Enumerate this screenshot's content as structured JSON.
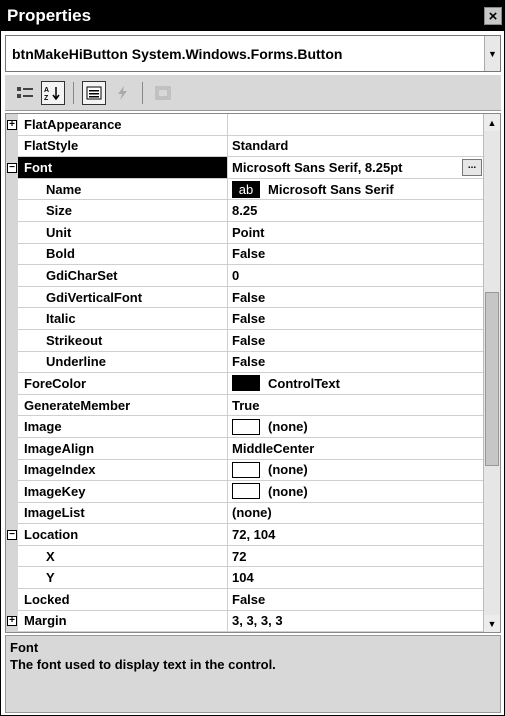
{
  "window": {
    "title": "Properties",
    "close_glyph": "×"
  },
  "object_selector": {
    "value": "btnMakeHiButton System.Windows.Forms.Button"
  },
  "toolbar": {
    "buttons": [
      "categorized-icon",
      "alphabetical-icon",
      "properties-icon",
      "events-icon",
      "property-pages-icon"
    ]
  },
  "rows": [
    {
      "name": "FlatAppearance",
      "value": "",
      "expander": "+",
      "indent": false
    },
    {
      "name": "FlatStyle",
      "value": "Standard",
      "indent": false
    },
    {
      "name": "Font",
      "value": "Microsoft Sans Serif, 8.25pt",
      "expander": "−",
      "selected": true,
      "indent": false,
      "button": "..."
    },
    {
      "name": "Name",
      "value": "Microsoft Sans Serif",
      "indent": true,
      "sample": "ab"
    },
    {
      "name": "Size",
      "value": "8.25",
      "indent": true
    },
    {
      "name": "Unit",
      "value": "Point",
      "indent": true
    },
    {
      "name": "Bold",
      "value": "False",
      "indent": true
    },
    {
      "name": "GdiCharSet",
      "value": "0",
      "indent": true
    },
    {
      "name": "GdiVerticalFont",
      "value": "False",
      "indent": true
    },
    {
      "name": "Italic",
      "value": "False",
      "indent": true
    },
    {
      "name": "Strikeout",
      "value": "False",
      "indent": true
    },
    {
      "name": "Underline",
      "value": "False",
      "indent": true
    },
    {
      "name": "ForeColor",
      "value": "ControlText",
      "indent": false,
      "swatch": "black"
    },
    {
      "name": "GenerateMember",
      "value": "True",
      "indent": false
    },
    {
      "name": "Image",
      "value": "(none)",
      "indent": false,
      "swatch": "white"
    },
    {
      "name": "ImageAlign",
      "value": "MiddleCenter",
      "indent": false
    },
    {
      "name": "ImageIndex",
      "value": "(none)",
      "indent": false,
      "swatch": "white"
    },
    {
      "name": "ImageKey",
      "value": "(none)",
      "indent": false,
      "swatch": "white"
    },
    {
      "name": "ImageList",
      "value": "(none)",
      "indent": false
    },
    {
      "name": "Location",
      "value": "72, 104",
      "expander": "−",
      "indent": false
    },
    {
      "name": "X",
      "value": "72",
      "indent": true
    },
    {
      "name": "Y",
      "value": "104",
      "indent": true
    },
    {
      "name": "Locked",
      "value": "False",
      "indent": false
    },
    {
      "name": "Margin",
      "value": "3, 3, 3, 3",
      "expander": "+",
      "indent": false
    }
  ],
  "description": {
    "title": "Font",
    "text": "The font used to display text in the control."
  }
}
